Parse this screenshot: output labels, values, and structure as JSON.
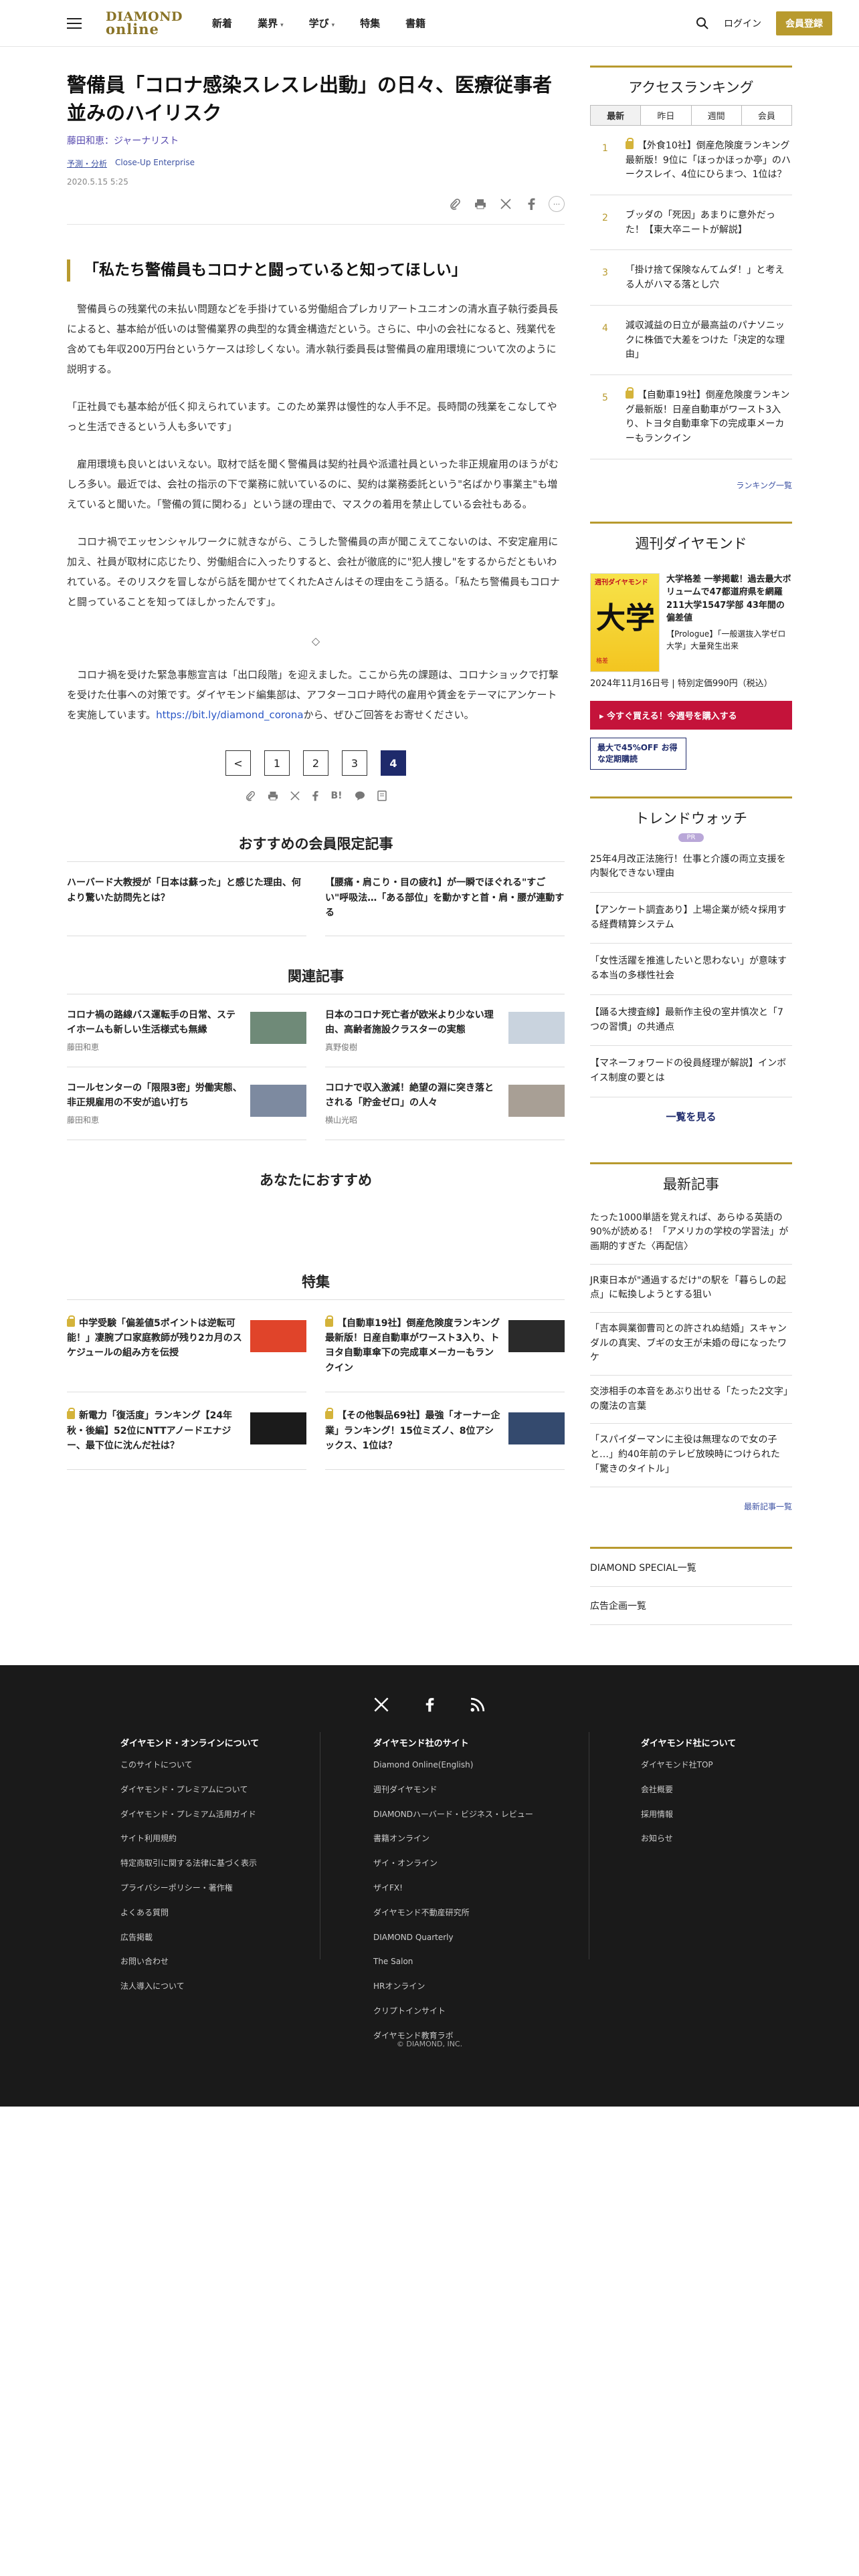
{
  "header": {
    "logo_top": "DIAMOND",
    "logo_bottom": "online",
    "nav": [
      {
        "label": "新着",
        "caret": ""
      },
      {
        "label": "業界",
        "caret": "▾"
      },
      {
        "label": "学び",
        "caret": "▾"
      },
      {
        "label": "特集",
        "caret": ""
      },
      {
        "label": "書籍",
        "caret": ""
      }
    ],
    "login": "ログイン",
    "member": "会員登録"
  },
  "article": {
    "title": "警備員「コロナ感染スレスレ出動」の日々、医療従事者並みのハイリスク",
    "author": "藤田和恵：ジャーナリスト",
    "category": "予測・分析",
    "series": "Close-Up Enterprise",
    "date": "2020.5.15 5:25",
    "subhead": "「私たち警備員もコロナと闘っていると知ってほしい」",
    "p1": "警備員らの残業代の未払い問題などを手掛けている労働組合プレカリアートユニオンの清水直子執行委員長によると、基本給が低いのは警備業界の典型的な賃金構造だという。さらに、中小の会社になると、残業代を含めても年収200万円台というケースは珍しくない。清水執行委員長は警備員の雇用環境について次のように説明する。",
    "p2": "「正社員でも基本給が低く抑えられています。このため業界は慢性的な人手不足。長時間の残業をこなしてやっと生活できるという人も多いです」",
    "p3": "雇用環境も良いとはいえない。取材で話を聞く警備員は契約社員や派遣社員といった非正規雇用のほうがむしろ多い。最近では、会社の指示の下で業務に就いているのに、契約は業務委託という\"名ばかり事業主\"も増えていると聞いた。「警備の質に関わる」という謎の理由で、マスクの着用を禁止している会社もある。",
    "p4": "コロナ禍でエッセンシャルワークに就きながら、こうした警備員の声が聞こえてこないのは、不安定雇用に加え、社員が取材に応じたり、労働組合に入ったりすると、会社が徹底的に\"犯人捜し\"をするからだともいわれている。そのリスクを冒しながら話を聞かせてくれたAさんはその理由をこう語る。「私たち警備員もコロナと闘っていることを知ってほしかったんです」。",
    "diamond": "◇",
    "p5_pre": "コロナ禍を受けた緊急事態宣言は「出口段階」を迎えました。ここから先の課題は、コロナショックで打撃を受けた仕事への対策です。ダイヤモンド編集部は、アフターコロナ時代の雇用や賃金をテーマにアンケートを実施しています。",
    "p5_link": "https://bit.ly/diamond_corona",
    "p5_post": "から、ぜひご回答をお寄せください。"
  },
  "pager": {
    "prev": "<",
    "pages": [
      "1",
      "2",
      "3",
      "4"
    ],
    "active": "4"
  },
  "share_icons": [
    "paperclip-icon",
    "print-icon",
    "x-icon",
    "facebook-icon",
    "more-icon"
  ],
  "sections": {
    "recommend_title": "おすすめの会員限定記事",
    "recommend": [
      "ハーバード大教授が「日本は蘇った」と感じた理由、何より驚いた訪問先とは？",
      "【腰痛・肩こり・目の疲れ】が一瞬でほぐれる\"すごい\"呼吸法…「ある部位」を動かすと首・肩・腰が連動する"
    ],
    "related_title": "関連記事",
    "related": [
      {
        "title": "コロナ禍の路線バス運転手の日常、ステイホームも新しい生活様式も無縁",
        "author": "藤田和恵",
        "thumb": "#6f8a78"
      },
      {
        "title": "日本のコロナ死亡者が欧米より少ない理由、高齢者施設クラスターの実態",
        "author": "真野俊樹",
        "thumb": "#c9d3de"
      },
      {
        "title": "コールセンターの「限限3密」労働実態、非正規雇用の不安が追い打ち",
        "author": "藤田和恵",
        "thumb": "#7d8aa0"
      },
      {
        "title": "コロナで収入激減！絶望の淵に突き落とされる「貯金ゼロ」の人々",
        "author": "横山光昭",
        "thumb": "#a89f95"
      }
    ],
    "foryou_title": "あなたにおすすめ",
    "feature_title": "特集",
    "features": [
      {
        "title": "中学受験「偏差値5ポイントは逆転可能！」凄腕プロ家庭教師が残り2カ月のスケジュールの組み方を伝授",
        "thumb": "#e0442a"
      },
      {
        "title": "【自動車19社】倒産危険度ランキング最新版！日産自動車がワースト3入り、トヨタ自動車傘下の完成車メーカーもランクイン",
        "thumb": "#2a2a2a"
      },
      {
        "title": "新電力「復活度」ランキング【24年秋・後編】52位にNTTアノードエナジー、最下位に沈んだ社は？",
        "thumb": "#1b1b1b"
      },
      {
        "title": "【その他製品69社】最強「オーナー企業」ランキング！15位ミズノ、8位アシックス、1位は？",
        "thumb": "#344a6e"
      }
    ]
  },
  "sidebar": {
    "ranking_title": "アクセスランキング",
    "tabs": [
      "最新",
      "昨日",
      "週間",
      "会員"
    ],
    "ranking": [
      {
        "no": "1",
        "title": "【外食10社】倒産危険度ランキング最新版！9位に「ほっかほっか亭」のハークスレイ、4位にひらまつ、1位は？",
        "locked": true
      },
      {
        "no": "2",
        "title": "ブッダの「死因」あまりに意外だった！【東大卒ニートが解説】",
        "locked": false
      },
      {
        "no": "3",
        "title": "「掛け捨て保険なんてムダ！」と考える人がハマる落とし穴",
        "locked": false
      },
      {
        "no": "4",
        "title": "減収減益の日立が最高益のパナソニックに株価で大差をつけた「決定的な理由」",
        "locked": false
      },
      {
        "no": "5",
        "title": "【自動車19社】倒産危険度ランキング最新版！日産自動車がワースト3入り、トヨタ自動車傘下の完成車メーカーもランクイン",
        "locked": true
      }
    ],
    "ranking_more": "ランキング一覧",
    "weekly_title": "週刊ダイヤモンド",
    "mag_cover_top": "週刊ダイヤモンド",
    "mag_cover_big": "大学",
    "mag_cover_sub": "格差",
    "mag_text": "大学格差 一挙掲載！過去最大ボリュームで47都道府県を網羅 211大学1547学部 43年間の偏差値",
    "mag_prologue": "【Prologue】「一般選抜入学ゼロ大学」大量発生出来",
    "mag_date": "2024年11月16日号 | 特別定価990円（税込）",
    "buy": "▸ 今すぐ買える！今週号を購入する",
    "subscribe": "最大で45%OFF お得な定期購読",
    "trend_title": "トレンドウォッチ",
    "trend_badge": "PR",
    "trends": [
      "25年4月改正法施行！仕事と介護の両立支援を内製化できない理由",
      "【アンケート調査あり】上場企業が続々採用する経費精算システム",
      "「女性活躍を推進したいと思わない」が意味する本当の多様性社会",
      "【踊る大捜査線】最新作主役の室井慎次と「7つの習慣」の共通点",
      "【マネーフォワードの役員経理が解説】インボイス制度の要とは"
    ],
    "trend_more": "一覧を見る",
    "latest_title": "最新記事",
    "latest": [
      "たった1000単語を覚えれば、あらゆる英語の90%が読める！「アメリカの学校の学習法」が画期的すぎた〈再配信〉",
      "JR東日本が\"通過するだけ\"の駅を「暮らしの起点」に転換しようとする狙い",
      "「吉本興業御曹司との許されぬ結婚」スキャンダルの真実、ブギの女王が未婚の母になったワケ",
      "交渉相手の本音をあぶり出せる「たった2文字」の魔法の言葉",
      "「スパイダーマンに主役は無理なので女の子と…」約40年前のテレビ放映時につけられた「驚きのタイトル」"
    ],
    "latest_more": "最新記事一覧",
    "special": "DIAMOND SPECIAL一覧",
    "ad": "広告企画一覧"
  },
  "footer": {
    "col1_title": "ダイヤモンド・オンラインについて",
    "col1": [
      "このサイトについて",
      "ダイヤモンド・プレミアムについて",
      "ダイヤモンド・プレミアム活用ガイド",
      "サイト利用規約",
      "特定商取引に関する法律に基づく表示",
      "プライバシーポリシー・著作権",
      "よくある質問",
      "広告掲載",
      "お問い合わせ",
      "法人導入について"
    ],
    "col2_title": "ダイヤモンド社のサイト",
    "col2": [
      "Diamond Online(English)",
      "週刊ダイヤモンド",
      "DIAMONDハーバード・ビジネス・レビュー",
      "書籍オンライン",
      "ザイ・オンライン",
      "ザイFX!",
      "ダイヤモンド不動産研究所",
      "DIAMOND Quarterly",
      "The Salon",
      "HRオンライン",
      "クリプトインサイト",
      "ダイヤモンド教育ラボ"
    ],
    "col3_title": "ダイヤモンド社について",
    "col3": [
      "ダイヤモンド社TOP",
      "会社概要",
      "採用情報",
      "お知らせ"
    ],
    "copyright": "© DIAMOND, INC."
  }
}
